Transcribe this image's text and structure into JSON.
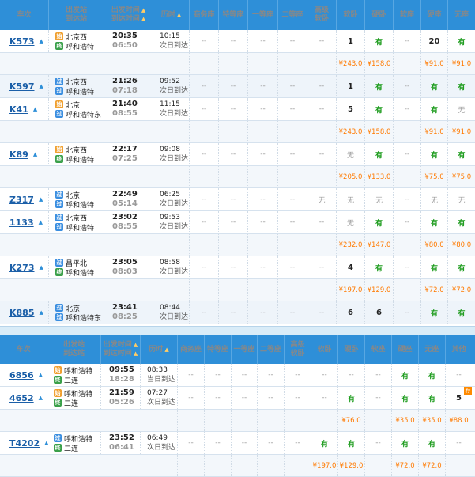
{
  "table_a": {
    "headers": {
      "train": "车次",
      "station_top": "出发站",
      "station_bottom": "到达站",
      "time_top": "出发时间",
      "time_bottom": "到达时间",
      "duration": "历时",
      "swz": "商务座",
      "tdz": "特等座",
      "ydz": "一等座",
      "edz": "二等座",
      "gjrw_top": "高级",
      "gjrw_bottom": "软卧",
      "rw": "软卧",
      "yw": "硬卧",
      "rz": "软座",
      "yz": "硬座",
      "wz": "无座"
    },
    "trains": [
      {
        "code": "K573",
        "from": "北京西",
        "from_type": "始",
        "to": "呼和浩特",
        "to_type": "终",
        "dep": "20:35",
        "arr": "06:50",
        "dur1": "10:15",
        "dur2": "次日到达",
        "seats": [
          "--",
          "--",
          "--",
          "--",
          "--",
          "1",
          "有",
          "--",
          "20",
          "有"
        ],
        "prices": [
          "",
          "",
          "",
          "",
          "",
          "¥243.0",
          "¥158.0",
          "",
          "¥91.0",
          "¥91.0"
        ]
      },
      {
        "code": "K597",
        "from": "北京西",
        "from_type": "过",
        "to": "呼和浩特",
        "to_type": "过",
        "dep": "21:26",
        "arr": "07:18",
        "dur1": "09:52",
        "dur2": "次日到达",
        "seats": [
          "--",
          "--",
          "--",
          "--",
          "--",
          "1",
          "有",
          "--",
          "有",
          "有"
        ],
        "prices": null
      },
      {
        "code": "K41",
        "from": "北京",
        "from_type": "始",
        "to": "呼和浩特东",
        "to_type": "过",
        "dep": "21:40",
        "arr": "08:55",
        "dur1": "11:15",
        "dur2": "次日到达",
        "seats": [
          "--",
          "--",
          "--",
          "--",
          "--",
          "5",
          "有",
          "--",
          "有",
          "无"
        ],
        "prices": [
          "",
          "",
          "",
          "",
          "",
          "¥243.0",
          "¥158.0",
          "",
          "¥91.0",
          "¥91.0"
        ]
      },
      {
        "code": "K89",
        "from": "北京西",
        "from_type": "始",
        "to": "呼和浩特",
        "to_type": "终",
        "dep": "22:17",
        "arr": "07:25",
        "dur1": "09:08",
        "dur2": "次日到达",
        "seats": [
          "--",
          "--",
          "--",
          "--",
          "--",
          "无",
          "有",
          "--",
          "有",
          "有"
        ],
        "prices": [
          "",
          "",
          "",
          "",
          "",
          "¥205.0",
          "¥133.0",
          "",
          "¥75.0",
          "¥75.0"
        ]
      },
      {
        "code": "Z317",
        "from": "北京",
        "from_type": "过",
        "to": "呼和浩特",
        "to_type": "过",
        "dep": "22:49",
        "arr": "05:14",
        "dur1": "06:25",
        "dur2": "次日到达",
        "seats": [
          "--",
          "--",
          "--",
          "--",
          "无",
          "无",
          "无",
          "--",
          "无",
          "无"
        ],
        "prices": null
      },
      {
        "code": "1133",
        "from": "北京西",
        "from_type": "过",
        "to": "呼和浩特",
        "to_type": "过",
        "dep": "23:02",
        "arr": "08:55",
        "dur1": "09:53",
        "dur2": "次日到达",
        "seats": [
          "--",
          "--",
          "--",
          "--",
          "--",
          "无",
          "有",
          "--",
          "有",
          "有"
        ],
        "prices": [
          "",
          "",
          "",
          "",
          "",
          "¥232.0",
          "¥147.0",
          "",
          "¥80.0",
          "¥80.0"
        ]
      },
      {
        "code": "K273",
        "from": "昌平北",
        "from_type": "过",
        "to": "呼和浩特",
        "to_type": "终",
        "dep": "23:05",
        "arr": "08:03",
        "dur1": "08:58",
        "dur2": "次日到达",
        "seats": [
          "--",
          "--",
          "--",
          "--",
          "--",
          "4",
          "有",
          "--",
          "有",
          "有"
        ],
        "prices": [
          "",
          "",
          "",
          "",
          "",
          "¥197.0",
          "¥129.0",
          "",
          "¥72.0",
          "¥72.0"
        ]
      },
      {
        "code": "K885",
        "from": "北京",
        "from_type": "过",
        "to": "呼和浩特东",
        "to_type": "过",
        "dep": "23:41",
        "arr": "08:25",
        "dur1": "08:44",
        "dur2": "次日到达",
        "seats": [
          "--",
          "--",
          "--",
          "--",
          "--",
          "6",
          "6",
          "--",
          "有",
          "有"
        ],
        "prices": null
      }
    ]
  },
  "table_b": {
    "headers": {
      "train": "车次",
      "station_top": "出发站",
      "station_bottom": "到达站",
      "time_top": "出发时间",
      "time_bottom": "到达时间",
      "duration": "历时",
      "swz": "商务座",
      "tdz": "特等座",
      "ydz": "一等座",
      "edz": "二等座",
      "gjrw_top": "高级",
      "gjrw_bottom": "软卧",
      "rw": "软卧",
      "yw": "硬卧",
      "rz": "软座",
      "yz": "硬座",
      "wz": "无座",
      "qt": "其他"
    },
    "corner_flag": "荐",
    "trains": [
      {
        "code": "6856",
        "from": "呼和浩特",
        "from_type": "始",
        "to": "二连",
        "to_type": "终",
        "dep": "09:55",
        "arr": "18:28",
        "dur1": "08:33",
        "dur2": "当日到达",
        "seats": [
          "--",
          "--",
          "--",
          "--",
          "--",
          "--",
          "--",
          "--",
          "有",
          "有",
          "--"
        ],
        "prices": null
      },
      {
        "code": "4652",
        "from": "呼和浩特",
        "from_type": "始",
        "to": "二连",
        "to_type": "终",
        "dep": "21:59",
        "arr": "05:26",
        "dur1": "07:27",
        "dur2": "次日到达",
        "seats": [
          "--",
          "--",
          "--",
          "--",
          "--",
          "--",
          "有",
          "--",
          "有",
          "有",
          "5"
        ],
        "prices": [
          "",
          "",
          "",
          "",
          "",
          "",
          "¥76.0",
          "",
          "¥35.0",
          "¥35.0",
          "¥88.0"
        ]
      },
      {
        "code": "T4202",
        "from": "呼和浩特",
        "from_type": "过",
        "to": "二连",
        "to_type": "终",
        "dep": "23:52",
        "arr": "06:41",
        "dur1": "06:49",
        "dur2": "次日到达",
        "seats": [
          "--",
          "--",
          "--",
          "--",
          "--",
          "有",
          "有",
          "--",
          "有",
          "有",
          "--"
        ],
        "prices": [
          "",
          "",
          "",
          "",
          "",
          "¥197.0",
          "¥129.0",
          "",
          "¥72.0",
          "¥72.0",
          ""
        ]
      }
    ]
  },
  "colors": {
    "header_bg": "#2e8fd8",
    "yes": "#1e9c1e",
    "price": "#ff7a00",
    "train_code": "#1b5fa8",
    "badge_start": "#f0a030",
    "badge_pass": "#3a8ee0",
    "badge_end": "#3aa04a"
  }
}
